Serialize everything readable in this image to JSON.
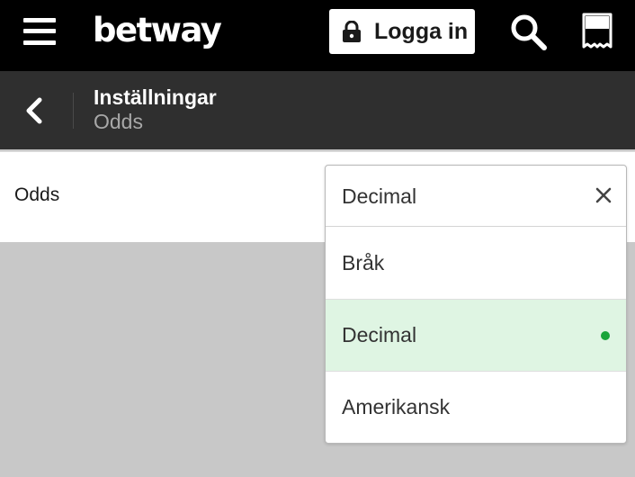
{
  "header": {
    "logo_text": "betway",
    "login_label": "Logga in",
    "icons": {
      "menu": "hamburger-menu-icon",
      "lock": "lock-icon",
      "search": "search-icon",
      "betslip": "betslip-icon"
    }
  },
  "subheader": {
    "title": "Inställningar",
    "subtitle": "Odds",
    "back_icon": "chevron-left-icon"
  },
  "settings": {
    "odds_label": "Odds"
  },
  "dropdown": {
    "selected_value": "Decimal",
    "close_icon": "close-icon",
    "options": [
      {
        "label": "Bråk",
        "selected": false
      },
      {
        "label": "Decimal",
        "selected": true
      },
      {
        "label": "Amerikansk",
        "selected": false
      }
    ]
  },
  "colors": {
    "topbar": "#000000",
    "subheader": "#2f2f2f",
    "backdrop": "#c8c8c8",
    "selected_bg": "#dff5e3",
    "selected_dot": "#1aa53a"
  }
}
